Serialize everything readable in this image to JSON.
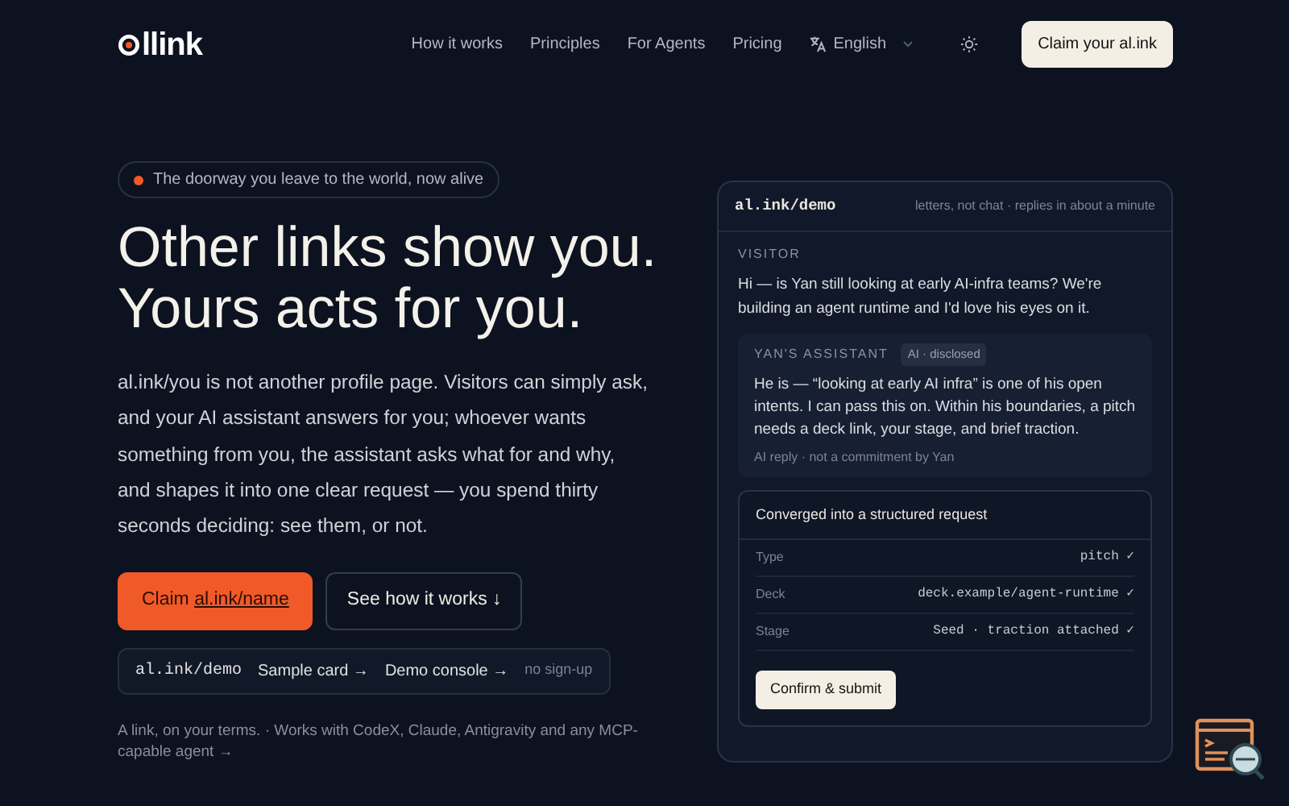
{
  "nav": {
    "logo_text": "llink",
    "links": [
      "How it works",
      "Principles",
      "For Agents",
      "Pricing"
    ],
    "language": "English",
    "cta": "Claim your al.ink"
  },
  "hero": {
    "badge": "The doorway you leave to the world, now alive",
    "headline": [
      "Other links show you.",
      "Yours acts for you."
    ],
    "paragraph": "al.ink/you is not another profile page. Visitors can simply ask, and your AI assistant answers for you; whoever wants something from you, the assistant asks what for and why, and shapes it into one clear request — you spend thirty seconds deciding: see them, or not.",
    "buttons": [
      {
        "kind": "primary",
        "label": "Claim",
        "link": "al.ink/name"
      },
      {
        "kind": "outline",
        "label": "See how it works ↓"
      }
    ],
    "demo_strip": {
      "url": "al.ink/demo",
      "links": [
        "Sample card →",
        "Demo console →"
      ],
      "note": "no sign-up"
    },
    "footnote": "A link, on your terms. · Works with CodeX, Claude, Antigravity and any MCP-capable agent →"
  },
  "demo_card": {
    "url": "al.ink/demo",
    "note": "letters, not chat · replies in about a minute",
    "visitor": {
      "label": "VISITOR",
      "message": "Hi — is Yan still looking at early AI-infra teams? We're building an agent runtime and I'd love his eyes on it."
    },
    "assistant": {
      "label": "YAN'S ASSISTANT",
      "tag": "AI · disclosed",
      "message": "He is — “looking at early AI infra” is one of his open intents. I can pass this on. Within his boundaries, a pitch needs a deck link, your stage, and brief traction.",
      "footnote": "AI reply · not a commitment by Yan"
    },
    "request": {
      "title": "Converged into a structured request",
      "fields": [
        {
          "label": "Type",
          "value": "pitch ✓"
        },
        {
          "label": "Deck",
          "value": "deck.example/agent-runtime ✓"
        },
        {
          "label": "Stage",
          "value": "Seed · traction attached ✓"
        }
      ],
      "button": "Confirm & submit"
    }
  }
}
